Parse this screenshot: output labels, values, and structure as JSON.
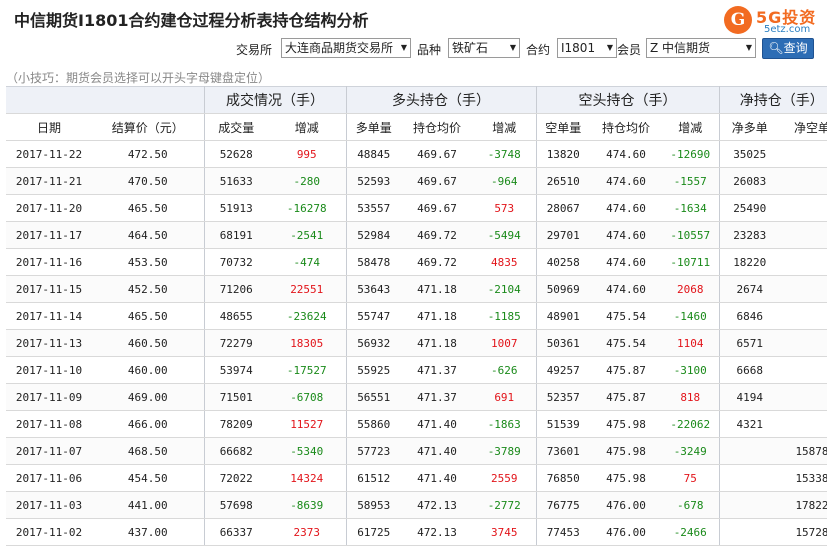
{
  "page_title": "中信期货I1801合约建仓过程分析表持仓结构分析",
  "logo": {
    "glyph": "G",
    "text": "5G投资",
    "url": "5etz.com"
  },
  "filters": {
    "exchange_label": "交易所",
    "exchange_value": "大连商品期货交易所",
    "variety_label": "品种",
    "variety_value": "铁矿石",
    "contract_label": "合约",
    "contract_value": "I1801",
    "member_label": "会员",
    "member_value": "Z 中信期货",
    "query_label": "查询"
  },
  "tip": "（小技巧：期货会员选择可以开头字母键盘定位）",
  "table": {
    "groups": {
      "trade": "成交情况（手）",
      "long": "多头持仓（手）",
      "short": "空头持仓（手）",
      "net": "净持仓（手）"
    },
    "columns": [
      "日期",
      "结算价（元）",
      "成交量",
      "增减",
      "多单量",
      "持仓均价",
      "增减",
      "空单量",
      "持仓均价",
      "增减",
      "净多单",
      "净空单"
    ],
    "rows": [
      [
        "2017-11-22",
        "472.50",
        "52628",
        "995",
        "48845",
        "469.67",
        "-3748",
        "13820",
        "474.60",
        "-12690",
        "35025",
        ""
      ],
      [
        "2017-11-21",
        "470.50",
        "51633",
        "-280",
        "52593",
        "469.67",
        "-964",
        "26510",
        "474.60",
        "-1557",
        "26083",
        ""
      ],
      [
        "2017-11-20",
        "465.50",
        "51913",
        "-16278",
        "53557",
        "469.67",
        "573",
        "28067",
        "474.60",
        "-1634",
        "25490",
        ""
      ],
      [
        "2017-11-17",
        "464.50",
        "68191",
        "-2541",
        "52984",
        "469.72",
        "-5494",
        "29701",
        "474.60",
        "-10557",
        "23283",
        ""
      ],
      [
        "2017-11-16",
        "453.50",
        "70732",
        "-474",
        "58478",
        "469.72",
        "4835",
        "40258",
        "474.60",
        "-10711",
        "18220",
        ""
      ],
      [
        "2017-11-15",
        "452.50",
        "71206",
        "22551",
        "53643",
        "471.18",
        "-2104",
        "50969",
        "474.60",
        "2068",
        "2674",
        ""
      ],
      [
        "2017-11-14",
        "465.50",
        "48655",
        "-23624",
        "55747",
        "471.18",
        "-1185",
        "48901",
        "475.54",
        "-1460",
        "6846",
        ""
      ],
      [
        "2017-11-13",
        "460.50",
        "72279",
        "18305",
        "56932",
        "471.18",
        "1007",
        "50361",
        "475.54",
        "1104",
        "6571",
        ""
      ],
      [
        "2017-11-10",
        "460.00",
        "53974",
        "-17527",
        "55925",
        "471.37",
        "-626",
        "49257",
        "475.87",
        "-3100",
        "6668",
        ""
      ],
      [
        "2017-11-09",
        "469.00",
        "71501",
        "-6708",
        "56551",
        "471.37",
        "691",
        "52357",
        "475.87",
        "818",
        "4194",
        ""
      ],
      [
        "2017-11-08",
        "466.00",
        "78209",
        "11527",
        "55860",
        "471.40",
        "-1863",
        "51539",
        "475.98",
        "-22062",
        "4321",
        ""
      ],
      [
        "2017-11-07",
        "468.50",
        "66682",
        "-5340",
        "57723",
        "471.40",
        "-3789",
        "73601",
        "475.98",
        "-3249",
        "",
        "15878"
      ],
      [
        "2017-11-06",
        "454.50",
        "72022",
        "14324",
        "61512",
        "471.40",
        "2559",
        "76850",
        "475.98",
        "75",
        "",
        "15338"
      ],
      [
        "2017-11-03",
        "441.00",
        "57698",
        "-8639",
        "58953",
        "472.13",
        "-2772",
        "76775",
        "476.00",
        "-678",
        "",
        "17822"
      ],
      [
        "2017-11-02",
        "437.00",
        "66337",
        "2373",
        "61725",
        "472.13",
        "3745",
        "77453",
        "476.00",
        "-2466",
        "",
        "15728"
      ]
    ]
  },
  "colors": {
    "increase": "#e2141a",
    "decrease": "#1a8a1a",
    "header_bg": "#eef1f7",
    "brand": "#f26b21",
    "button": "#2d6db5"
  }
}
